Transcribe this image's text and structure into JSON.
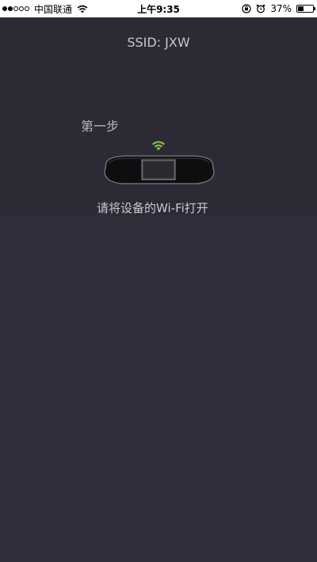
{
  "status_bar": {
    "carrier": "中国联通",
    "time": "上午9:35",
    "battery_percent": "37%",
    "battery_level": 0.37,
    "signal_bars_filled": 2,
    "signal_bars_total": 5
  },
  "header": {
    "ssid": "SSID: JXW"
  },
  "step": {
    "label": "第一步",
    "instruction": "请将设备的Wi-Fi打开"
  },
  "icons": {
    "wifi_status": "wifi-icon",
    "rotation_lock": "rotation-lock-icon",
    "alarm": "alarm-icon",
    "battery": "battery-icon",
    "device": "rearview-mirror-device-icon",
    "device_wifi": "wifi-signal-icon"
  },
  "colors": {
    "background": "#2f2d38",
    "wifi_green": "#7dc242"
  }
}
